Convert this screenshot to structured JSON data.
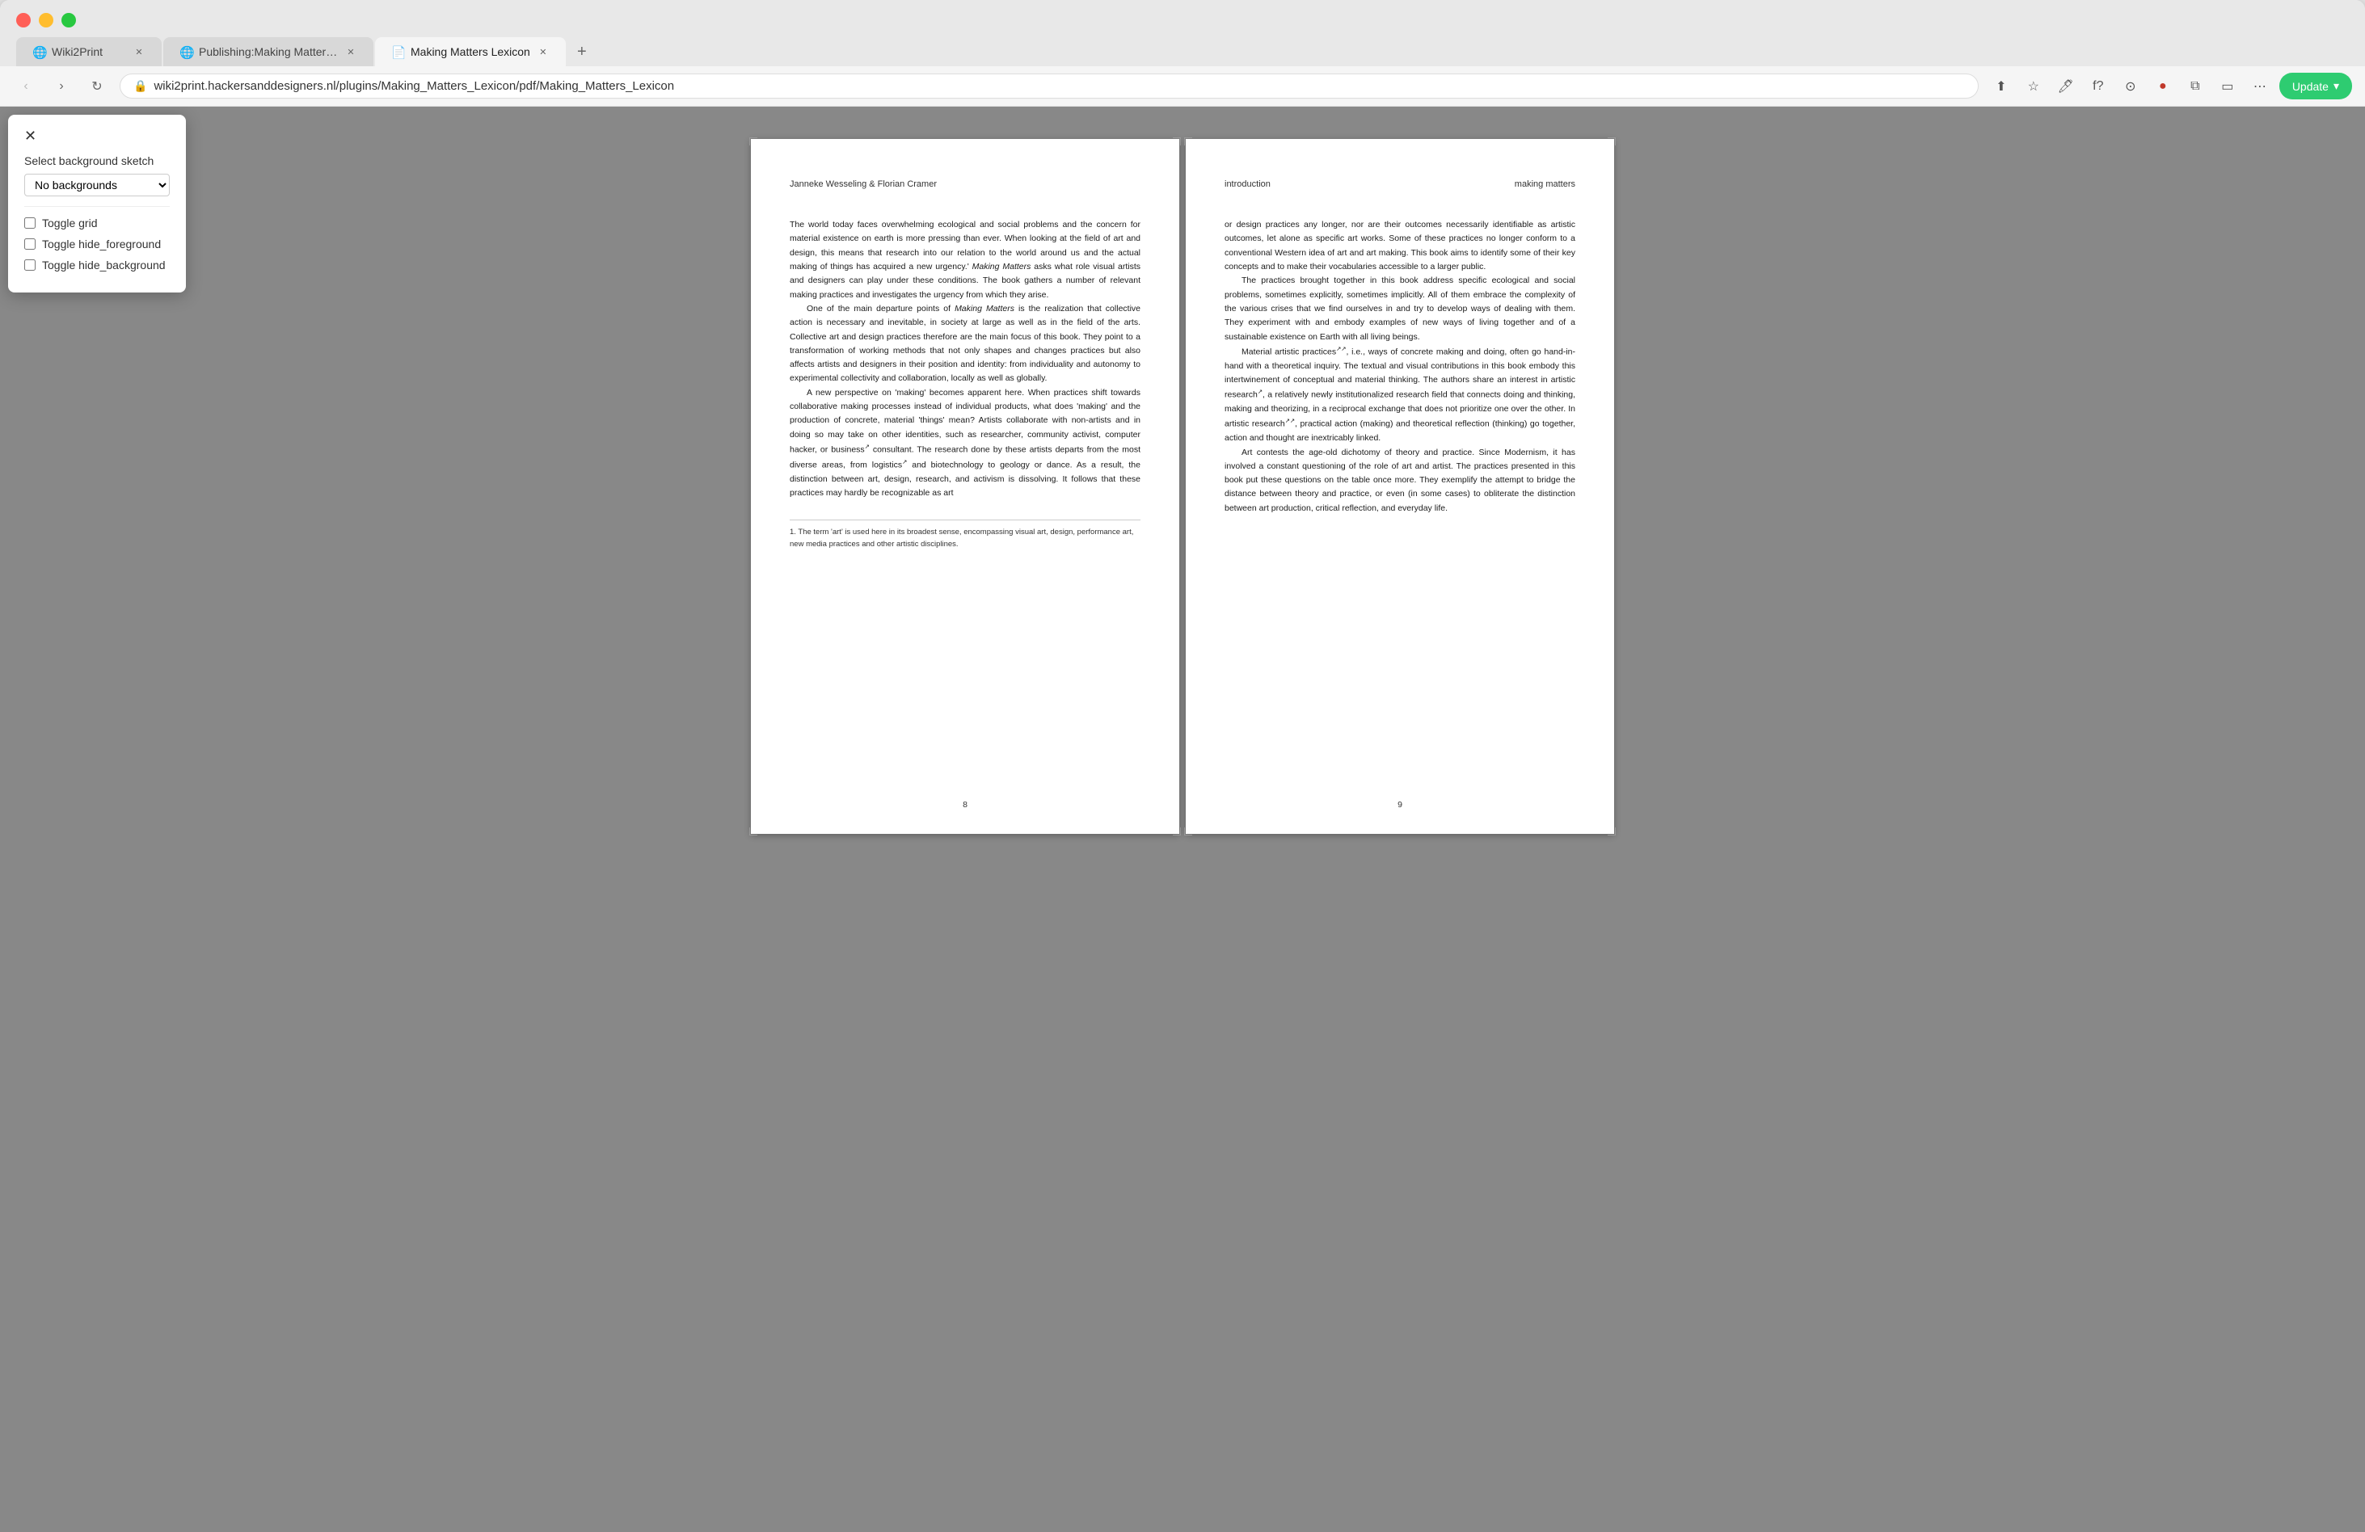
{
  "browser": {
    "tabs": [
      {
        "id": "tab1",
        "label": "Wiki2Print",
        "favicon": "🌐",
        "active": false
      },
      {
        "id": "tab2",
        "label": "Publishing:Making Matters Le...",
        "favicon": "🌐",
        "active": false
      },
      {
        "id": "tab3",
        "label": "Making Matters Lexicon",
        "favicon": "📄",
        "active": true
      }
    ],
    "url": "wiki2print.hackersanddesigners.nl/plugins/Making_Matters_Lexicon/pdf/Making_Matters_Lexicon",
    "update_btn": "Update"
  },
  "popup": {
    "label": "Select background sketch",
    "select_value": "No backgrounds",
    "select_options": [
      "No backgrounds"
    ],
    "checkbox1": "Toggle grid",
    "checkbox2": "Toggle hide_foreground",
    "checkbox3": "Toggle hide_background"
  },
  "page_left": {
    "author": "Janneke Wesseling & Florian Cramer",
    "page_num": "8",
    "body": "The world today faces overwhelming ecological and social problems and the concern for material existence on earth is more pressing than ever. When looking at the field of art and design, this means that research into our relation to the world around us and the actual making of things has acquired a new urgency. Making Matters asks what role visual artists and designers can play under these conditions. The book gathers a number of relevant making practices and investigates the urgency from which they arise.\n\nOne of the main departure points of Making Matters is the realization that collective action is necessary and inevitable, in society at large as well as in the field of the arts. Collective art and design practices therefore are the main focus of this book. They point to a transformation of working methods that not only shapes and changes practices but also affects artists and designers in their position and identity: from individuality and autonomy to experimental collectivity and collaboration, locally as well as globally.\n\nA new perspective on 'making' becomes apparent here. When practices shift towards collaborative making processes instead of individual products, what does 'making' and the production of concrete, material 'things' mean? Artists collaborate with non-artists and in doing so may take on other identities, such as researcher, community activist, computer hacker, or business consultant. The research done by these artists departs from the most diverse areas, from logistics and biotechnology to geology or dance. As a result, the distinction between art, design, research, and activism is dissolving. It follows that these practices may hardly be recognizable as art",
    "footnote": "1. The term 'art' is used here in its broadest sense, encompassing visual art, design, performance art, new media practices and other artistic disciplines."
  },
  "page_right": {
    "section_left": "introduction",
    "section_right": "making matters",
    "page_num": "9",
    "body": "or design practices any longer, nor are their outcomes necessarily identifiable as artistic outcomes, let alone as specific art works. Some of these practices no longer conform to a conventional Western idea of art and art making. This book aims to identify some of their key concepts and to make their vocabularies accessible to a larger public.\n\nThe practices brought together in this book address specific ecological and social problems, sometimes explicitly, sometimes implicitly. All of them embrace the complexity of the various crises that we find ourselves in and try to develop ways of dealing with them. They experiment with and embody examples of new ways of living together and of a sustainable existence on Earth with all living beings.\n\nMaterial artistic practices, i.e., ways of concrete making and doing, often go hand-in-hand with a theoretical inquiry. The textual and visual contributions in this book embody this intertwinement of conceptual and material thinking. The authors share an interest in artistic research, a relatively newly institutionalized research field that connects doing and thinking, making and theorizing, in a reciprocal exchange that does not prioritize one over the other. In artistic research, practical action (making) and theoretical reflection (thinking) go together, action and thought are inextricably linked.\n\nArt contests the age-old dichotomy of theory and practice. Since Modernism, it has involved a constant questioning of the role of art and artist. The practices presented in this book put these questions on the table once more. They exemplify the attempt to bridge the distance between theory and practice, or even (in some cases) to obliterate the distinction between art production, critical reflection, and everyday life."
  }
}
